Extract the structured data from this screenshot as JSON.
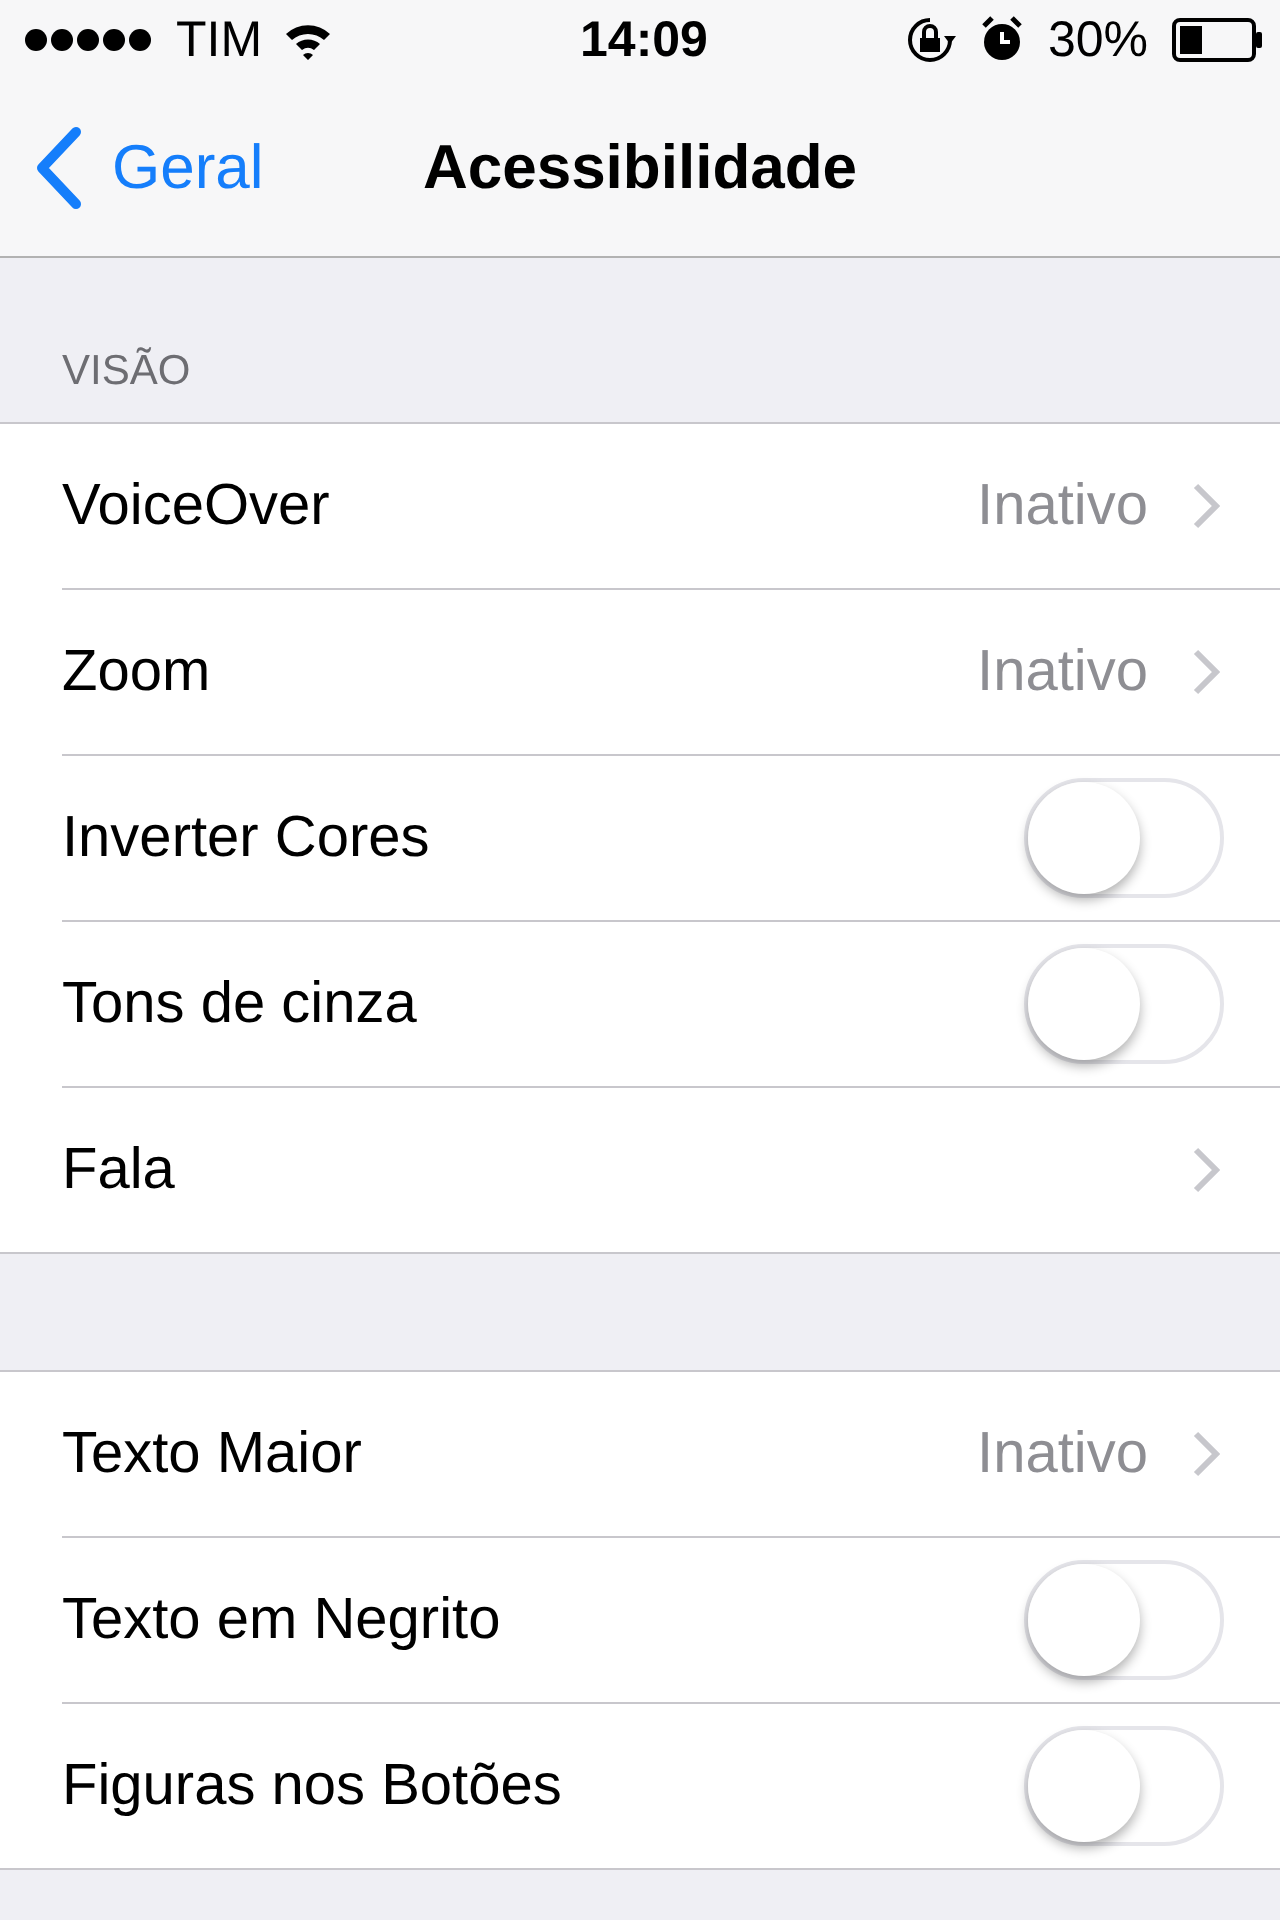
{
  "status_bar": {
    "carrier": "TIM",
    "time": "14:09",
    "battery": "30%"
  },
  "nav_bar": {
    "back": "Geral",
    "title": "Acessibilidade"
  },
  "sections": [
    {
      "header": "VISÃO",
      "rows": [
        {
          "kind": "link",
          "label": "VoiceOver",
          "value": "Inativo"
        },
        {
          "kind": "link",
          "label": "Zoom",
          "value": "Inativo"
        },
        {
          "kind": "toggle",
          "label": "Inverter Cores",
          "on": false
        },
        {
          "kind": "toggle",
          "label": "Tons de cinza",
          "on": false
        },
        {
          "kind": "link",
          "label": "Fala"
        }
      ]
    },
    {
      "rows": [
        {
          "kind": "link",
          "label": "Texto Maior",
          "value": "Inativo"
        },
        {
          "kind": "toggle",
          "label": "Texto em Negrito",
          "on": false
        },
        {
          "kind": "toggle",
          "label": "Figuras nos Botões",
          "on": false
        }
      ]
    }
  ]
}
